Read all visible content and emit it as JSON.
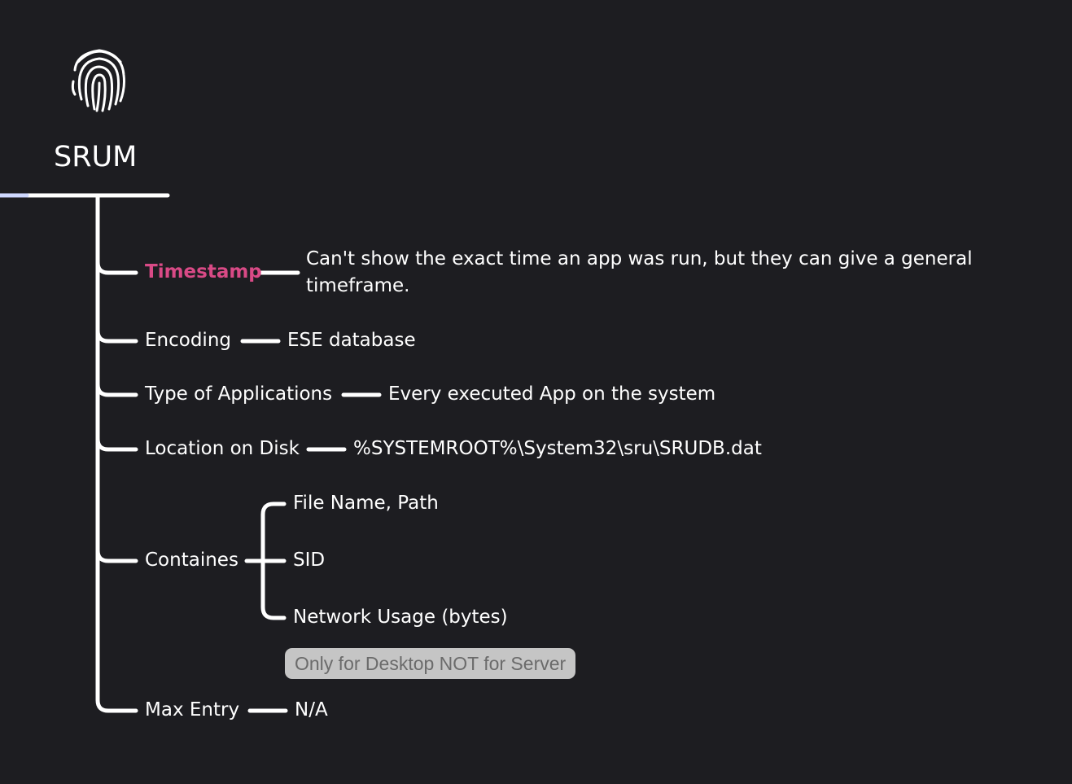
{
  "root": {
    "title": "SRUM",
    "icon": "fingerprint-icon"
  },
  "branches": [
    {
      "label": "Timestamp",
      "value": "Can't show the exact time an app was run, but they can give a general timeframe.",
      "highlight": true
    },
    {
      "label": "Encoding",
      "value": "ESE database"
    },
    {
      "label": "Type of Applications",
      "value": "Every executed App on the system"
    },
    {
      "label": "Location on Disk",
      "value": "%SYSTEMROOT%\\System32\\sru\\SRUDB.dat"
    },
    {
      "label": "Containes",
      "children": [
        "File Name, Path",
        "SID",
        "Network Usage (bytes)"
      ],
      "note": "Only for Desktop NOT for Server"
    },
    {
      "label": "Max Entry",
      "value": "N/A"
    }
  ],
  "colors": {
    "background": "#1d1d21",
    "line": "#ffffff",
    "text": "#ffffff",
    "highlight": "#d94a86",
    "note_background": "#c5c5c5",
    "note_text": "#6b6b6b"
  }
}
